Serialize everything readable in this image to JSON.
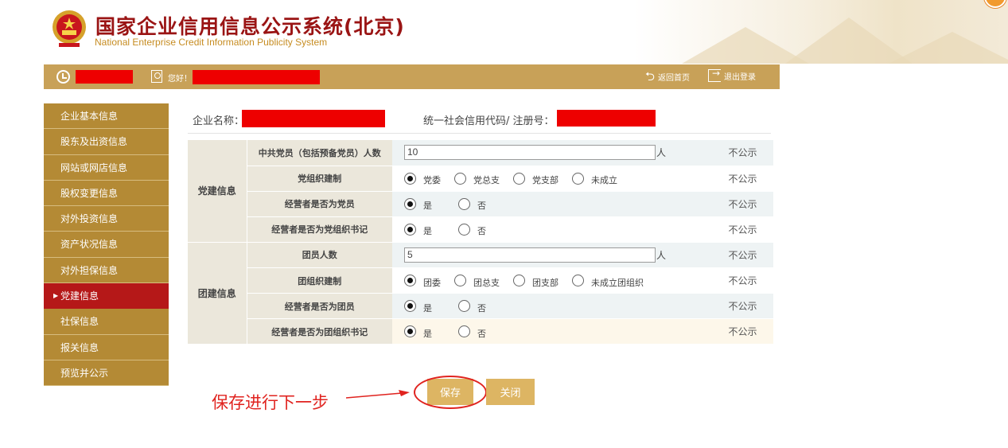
{
  "header": {
    "title_cn": "国家企业信用信息公示系统(北京)",
    "title_en": "National Enterprise Credit Information Publicity System"
  },
  "topbar": {
    "greeting": "您好！",
    "back_home": "返回首页",
    "logout": "退出登录"
  },
  "sidebar": {
    "items": [
      {
        "label": "企业基本信息"
      },
      {
        "label": "股东及出资信息"
      },
      {
        "label": "网站或网店信息"
      },
      {
        "label": "股权变更信息"
      },
      {
        "label": "对外投资信息"
      },
      {
        "label": "资产状况信息"
      },
      {
        "label": "对外担保信息"
      },
      {
        "label": "党建信息",
        "active": true
      },
      {
        "label": "社保信息"
      },
      {
        "label": "报关信息"
      },
      {
        "label": "预览并公示"
      }
    ]
  },
  "company": {
    "name_label": "企业名称：",
    "code_label": "统一社会信用代码/ 注册号："
  },
  "form": {
    "party_group": "党建信息",
    "league_group": "团建信息",
    "rows": [
      {
        "label": "中共党员（包括预备党员）人数",
        "value": "10",
        "unit": "人",
        "status": "不公示"
      },
      {
        "label": "党组织建制",
        "options": [
          "党委",
          "党总支",
          "党支部",
          "未成立"
        ],
        "selected": "党委",
        "status": "不公示"
      },
      {
        "label": "经营者是否为党员",
        "options": [
          "是",
          "否"
        ],
        "selected": "是",
        "status": "不公示"
      },
      {
        "label": "经营者是否为党组织书记",
        "options": [
          "是",
          "否"
        ],
        "selected": "是",
        "status": "不公示"
      },
      {
        "label": "团员人数",
        "value": "5",
        "unit": "人",
        "status": "不公示"
      },
      {
        "label": "团组织建制",
        "options": [
          "团委",
          "团总支",
          "团支部",
          "未成立团组织"
        ],
        "selected": "团委",
        "status": "不公示"
      },
      {
        "label": "经营者是否为团员",
        "options": [
          "是",
          "否"
        ],
        "selected": "是",
        "status": "不公示"
      },
      {
        "label": "经营者是否为团组织书记",
        "options": [
          "是",
          "否"
        ],
        "selected": "是",
        "status": "不公示"
      }
    ]
  },
  "actions": {
    "save": "保存",
    "close": "关闭"
  },
  "annotation": {
    "text": "保存进行下一步",
    "color": "#e0231f"
  },
  "colors": {
    "gold": "#c8a158",
    "sidebar": "#b48a35",
    "active": "#b51818",
    "title": "#9a1414"
  }
}
